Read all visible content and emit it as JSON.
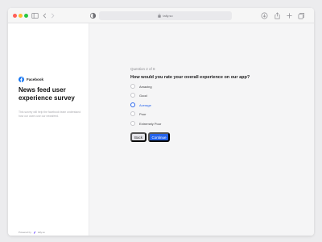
{
  "browser": {
    "url": "tally.so",
    "icons": {
      "sidebar_toggle": "sidebar-icon",
      "back": "chevron-left-icon",
      "forward": "chevron-right-icon",
      "privacy": "shield-icon",
      "download": "download-icon",
      "share": "share-icon",
      "new_tab": "plus-icon",
      "tabs": "tabs-icon"
    }
  },
  "sidebar": {
    "brand_name": "Facebook",
    "title": "News feed user experience survey",
    "description": "This survey will help the facebook team understand how our users use our newsfeed.",
    "powered_label": "Powered by",
    "powered_name": "tally.so"
  },
  "survey": {
    "progress": "Question 2 of 8",
    "question": "How would you rate your overall experience on our app?",
    "options": [
      {
        "label": "Amazing",
        "selected": false
      },
      {
        "label": "Good",
        "selected": false
      },
      {
        "label": "Average",
        "selected": true
      },
      {
        "label": "Poor",
        "selected": false
      },
      {
        "label": "Extremely Poor",
        "selected": false
      }
    ],
    "back_label": "Back",
    "continue_label": "Continue"
  },
  "colors": {
    "accent": "#2563eb",
    "brand_facebook": "#1877f2",
    "close": "#ff5f57",
    "minimize": "#febc2e",
    "maximize": "#28c840"
  }
}
